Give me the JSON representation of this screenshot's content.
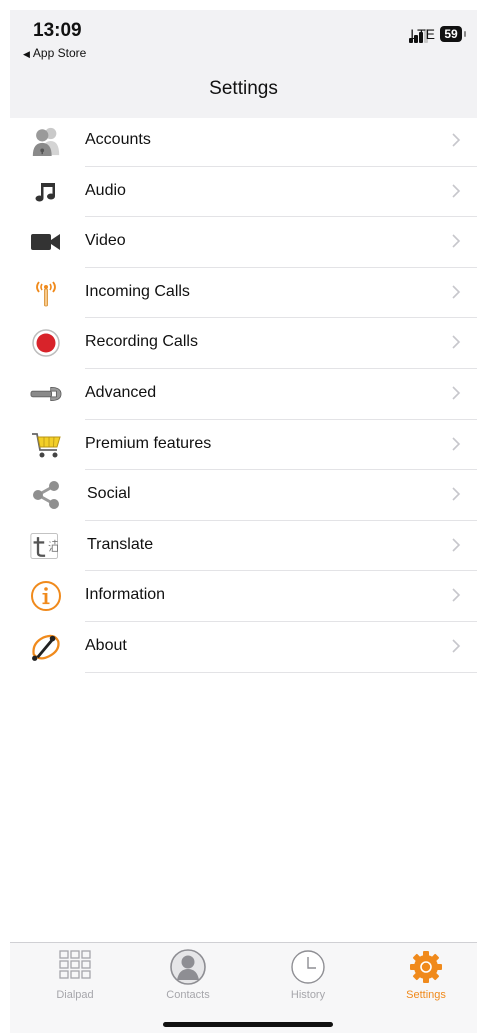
{
  "status": {
    "time": "13:09",
    "back_app": "App Store",
    "network": "LTE",
    "battery": "59"
  },
  "header": {
    "title": "Settings"
  },
  "settings": {
    "items": [
      {
        "label": "Accounts",
        "icon": "accounts-icon"
      },
      {
        "label": "Audio",
        "icon": "music-note-icon"
      },
      {
        "label": "Video",
        "icon": "video-camera-icon"
      },
      {
        "label": "Incoming Calls",
        "icon": "antenna-icon"
      },
      {
        "label": "Recording Calls",
        "icon": "record-icon"
      },
      {
        "label": "Advanced",
        "icon": "wrench-icon"
      },
      {
        "label": "Premium features",
        "icon": "shopping-cart-icon"
      },
      {
        "label": "Social",
        "icon": "share-icon"
      },
      {
        "label": "Translate",
        "icon": "translate-icon"
      },
      {
        "label": "Information",
        "icon": "info-icon"
      },
      {
        "label": "About",
        "icon": "about-icon"
      }
    ]
  },
  "tabbar": {
    "tabs": [
      {
        "label": "Dialpad",
        "icon": "dialpad-icon",
        "active": false
      },
      {
        "label": "Contacts",
        "icon": "contacts-icon",
        "active": false
      },
      {
        "label": "History",
        "icon": "clock-icon",
        "active": false
      },
      {
        "label": "Settings",
        "icon": "gear-icon",
        "active": true
      }
    ]
  },
  "colors": {
    "accent": "#f08a1c",
    "record_red": "#d8232a",
    "separator": "#e3e3e6"
  }
}
